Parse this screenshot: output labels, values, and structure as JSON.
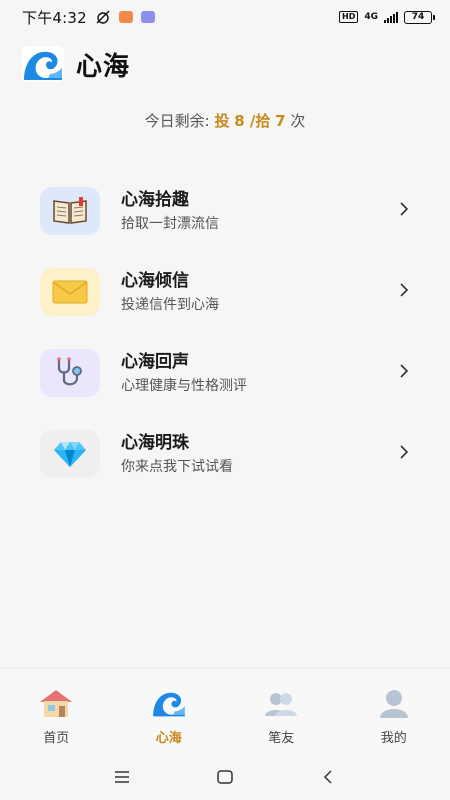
{
  "status_bar": {
    "time": "下午4:32",
    "network": "4G",
    "hd": "HD",
    "battery": "74"
  },
  "header": {
    "title": "心海"
  },
  "quota": {
    "prefix": "今日剩余: ",
    "throw_label": "投",
    "throw_count": "8",
    "separator": " /",
    "pick_label": "拾",
    "pick_count": "7",
    "suffix": " 次"
  },
  "menu": [
    {
      "title": "心海拾趣",
      "subtitle": "拾取一封漂流信",
      "icon": "book-icon",
      "bg": "#dde9fb"
    },
    {
      "title": "心海倾信",
      "subtitle": "投递信件到心海",
      "icon": "envelope-icon",
      "bg": "#fdf1c8"
    },
    {
      "title": "心海回声",
      "subtitle": "心理健康与性格测评",
      "icon": "stethoscope-icon",
      "bg": "#ebe6fb"
    },
    {
      "title": "心海明珠",
      "subtitle": "你来点我下试试看",
      "icon": "diamond-icon",
      "bg": "#efefef"
    }
  ],
  "bottom_nav": {
    "tabs": [
      {
        "label": "首页",
        "icon": "house-icon",
        "active": false
      },
      {
        "label": "心海",
        "icon": "wave-icon",
        "active": true
      },
      {
        "label": "笔友",
        "icon": "users-icon",
        "active": false
      },
      {
        "label": "我的",
        "icon": "user-icon",
        "active": false
      }
    ]
  },
  "colors": {
    "accent": "#c98a1a",
    "background": "#f6f6f7",
    "wave_blue": "#1e88e5"
  }
}
